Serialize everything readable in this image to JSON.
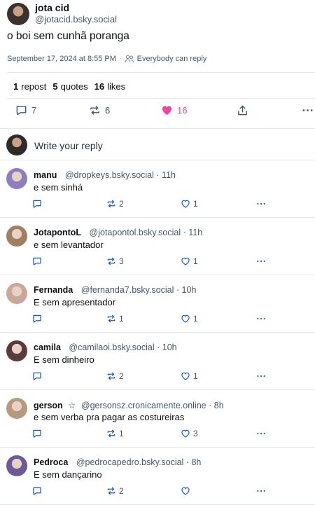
{
  "post": {
    "author_name": "jota cid",
    "author_handle": "@jotacid.bsky.social",
    "text": "o boi sem cunhã poranga",
    "timestamp": "September 17, 2024 at 8:55 PM",
    "reply_setting": "Everybody can reply",
    "stats": {
      "reposts_count": "1",
      "reposts_label": "repost",
      "quotes_count": "5",
      "quotes_label": "quotes",
      "likes_count": "16",
      "likes_label": "likes"
    },
    "actions": {
      "reply_count": "7",
      "repost_count": "6",
      "like_count": "16"
    }
  },
  "reply_box": {
    "placeholder": "Write your reply"
  },
  "replies": [
    {
      "name": "manu",
      "glyph": "",
      "handle": "@dropkeys.bsky.social",
      "time": "· 11h",
      "text": "e sem sinhá",
      "reply_count": "",
      "repost_count": "2",
      "like_count": "1",
      "avatar_color": "#8c7fbf"
    },
    {
      "name": "JotapontoL",
      "glyph": "",
      "handle": "@jotapontol.bsky.social",
      "time": "· 11h",
      "text": "e sem levantador",
      "reply_count": "",
      "repost_count": "3",
      "like_count": "1",
      "avatar_color": "#a08060"
    },
    {
      "name": "Fernanda",
      "glyph": "",
      "handle": "@fernanda7.bsky.social",
      "time": "· 10h",
      "text": "E sem apresentador",
      "reply_count": "",
      "repost_count": "1",
      "like_count": "1",
      "avatar_color": "#c9a79a"
    },
    {
      "name": "camila",
      "glyph": "",
      "handle": "@camilaoi.bsky.social",
      "time": "· 10h",
      "text": "E sem dinheiro",
      "reply_count": "",
      "repost_count": "2",
      "like_count": "1",
      "avatar_color": "#5a3a3a"
    },
    {
      "name": "gerson",
      "glyph": "☆",
      "handle": "@gersonsz.cronicamente.online",
      "time": "· 8h",
      "text": "e sem verba pra pagar as costureiras",
      "reply_count": "",
      "repost_count": "1",
      "like_count": "3",
      "avatar_color": "#b59a80"
    },
    {
      "name": "Pedroca",
      "glyph": "",
      "handle": "@pedrocapedro.bsky.social",
      "time": "· 8h",
      "text": "E sem dançarino",
      "reply_count": "",
      "repost_count": "2",
      "like_count": "",
      "avatar_color": "#6a5a9a"
    }
  ],
  "colors": {
    "like_active": "#ec4899",
    "muted": "#42576c",
    "reply_action": "#1e5aa8",
    "divider": "#e3e6ea"
  }
}
